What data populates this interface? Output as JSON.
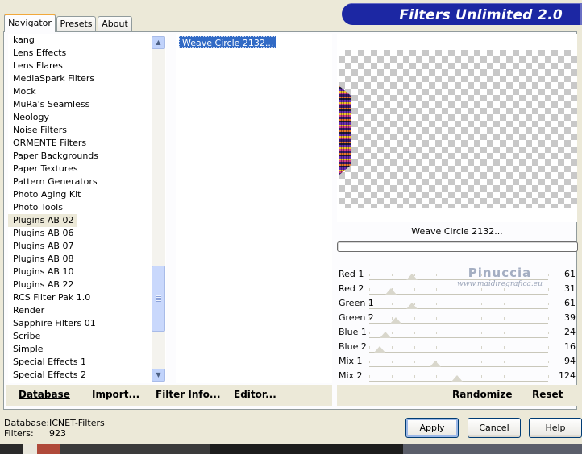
{
  "window": {
    "banner_title": "Filters Unlimited 2.0"
  },
  "tabs": [
    {
      "label": "Navigator",
      "active": true
    },
    {
      "label": "Presets",
      "active": false
    },
    {
      "label": "About",
      "active": false
    }
  ],
  "categories": {
    "items": [
      "kang",
      "Lens Effects",
      "Lens Flares",
      "MediaSpark Filters",
      "Mock",
      "MuRa's Seamless",
      "Neology",
      "Noise Filters",
      "ORMENTE Filters",
      "Paper Backgrounds",
      "Paper Textures",
      "Pattern Generators",
      "Photo Aging Kit",
      "Photo Tools",
      "Plugins AB 02",
      "Plugins AB 06",
      "Plugins AB 07",
      "Plugins AB 08",
      "Plugins AB 10",
      "Plugins AB 22",
      "RCS Filter Pak 1.0",
      "Render",
      "Sapphire Filters 01",
      "Scribe",
      "Simple",
      "Special Effects 1",
      "Special Effects 2"
    ],
    "selected": "Plugins AB 02"
  },
  "filters": {
    "selected": "Weave Circle 2132..."
  },
  "preview": {
    "caption": "Weave Circle 2132..."
  },
  "sliders": [
    {
      "label": "Red 1",
      "value": "61",
      "fraction": 0.24
    },
    {
      "label": "Red 2",
      "value": "31",
      "fraction": 0.12
    },
    {
      "label": "Green 1",
      "value": "61",
      "fraction": 0.24
    },
    {
      "label": "Green 2",
      "value": "39",
      "fraction": 0.15
    },
    {
      "label": "Blue 1",
      "value": "24",
      "fraction": 0.09
    },
    {
      "label": "Blue 2",
      "value": "16",
      "fraction": 0.06
    },
    {
      "label": "Mix 1",
      "value": "94",
      "fraction": 0.37
    },
    {
      "label": "Mix 2",
      "value": "124",
      "fraction": 0.49
    }
  ],
  "watermark": {
    "name": "Pinuccia",
    "site": "www.maidiregrafica.eu"
  },
  "toolbar": {
    "database_label": "Database",
    "import_label": "Import...",
    "filter_info_label": "Filter Info...",
    "editor_label": "Editor...",
    "randomize_label": "Randomize",
    "reset_label": "Reset"
  },
  "status": {
    "database_key": "Database:",
    "database_value": "ICNET-Filters",
    "filters_key": "Filters:",
    "filters_value": "923"
  },
  "dialog": {
    "apply_label": "Apply",
    "cancel_label": "Cancel",
    "help_label": "Help"
  },
  "colors": {
    "banner": "#1c27a3",
    "selection": "#316ac5",
    "window_bg": "#ece9d8"
  }
}
